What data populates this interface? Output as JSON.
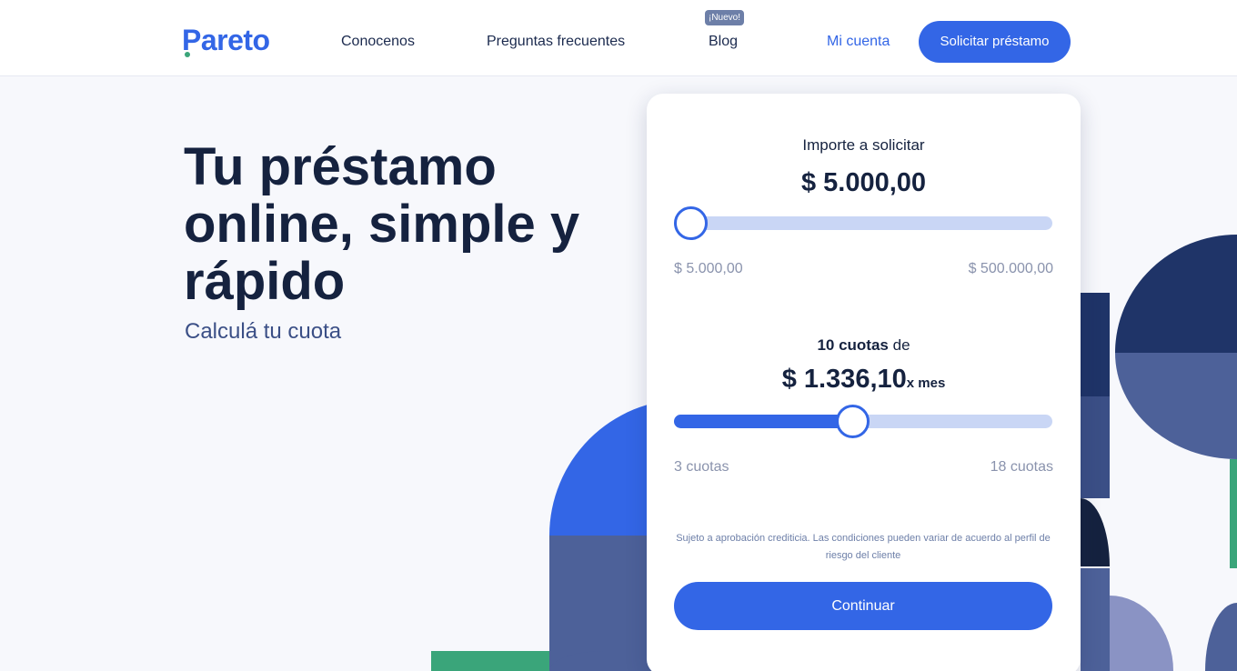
{
  "header": {
    "logo": "Pareto",
    "nav": {
      "conocenos": "Conocenos",
      "preguntas": "Preguntas frecuentes",
      "blog": "Blog",
      "blog_badge": "¡Nuevo!",
      "mi_cuenta": "Mi cuenta"
    },
    "cta": "Solicitar préstamo"
  },
  "hero": {
    "title": "Tu préstamo online, simple y rápido",
    "subtitle": "Calculá tu cuota"
  },
  "calculator": {
    "importe": {
      "label": "Importe a solicitar",
      "value": "$ 5.000,00",
      "min_label": "$ 5.000,00",
      "max_label": "$ 500.000,00",
      "slider_fraction": 0.0
    },
    "cuotas": {
      "count_label": "10 cuotas",
      "connector": "de",
      "amount": "$ 1.336,10",
      "per_unit": "x mes",
      "min_label": "3 cuotas",
      "max_label": "18 cuotas",
      "slider_fraction": 0.47
    },
    "disclaimer": "Sujeto a aprobación crediticia. Las condiciones pueden variar de acuerdo al perfil de riesgo del cliente",
    "continue": "Continuar"
  },
  "colors": {
    "primary": "#3366e6",
    "navy": "#15223f",
    "slate": "#4d6199",
    "green": "#3aa57a",
    "track": "#c9d6f5"
  }
}
